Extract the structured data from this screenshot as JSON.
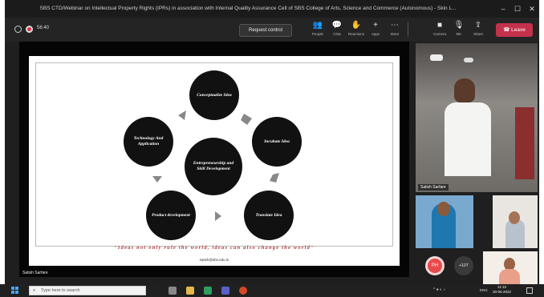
{
  "window": {
    "title": "SBS CTD/Webinar on Intellectual Property Rights (IPRs) in association with Internal Quality Assurance Cell of SBS College of Arts, Science and Commerce (Autonomous) - Skin L...",
    "controls": [
      "–",
      "☐",
      "✕"
    ]
  },
  "meeting_bar": {
    "timer": "56:40",
    "request_control": "Request control",
    "buttons": [
      {
        "label": "People",
        "icon": "people-icon"
      },
      {
        "label": "Chat",
        "icon": "chat-icon"
      },
      {
        "label": "Reactions",
        "icon": "reactions-icon"
      },
      {
        "label": "Apps",
        "icon": "apps-icon"
      },
      {
        "label": "More",
        "icon": "more-icon"
      },
      {
        "label": "Camera",
        "icon": "camera-icon"
      },
      {
        "label": "Mic",
        "icon": "mic-icon"
      },
      {
        "label": "Share",
        "icon": "share-icon"
      }
    ],
    "leave": "Leave"
  },
  "slide": {
    "nodes": [
      {
        "label": "Conceptualize Idea"
      },
      {
        "label": "Incubate Idea"
      },
      {
        "label": "Translate Idea"
      },
      {
        "label": "Product development"
      },
      {
        "label": "Technology And Application"
      },
      {
        "label": "Entrepreneurship and Skill Development"
      }
    ],
    "quote": "\"Ideas not only rule the world, ideas can also change the world\"",
    "email": "satish@sbs.edu.in"
  },
  "presenter_label": "Satish Sarfare",
  "side": {
    "main_tile_name": "Satish Sarfare",
    "avatar_initials": "PH",
    "overflow_count": "+107"
  },
  "taskbar": {
    "search_placeholder": "Type here to search",
    "clock_time": "11:10",
    "clock_date": "30-05-2022",
    "language": "ENG"
  },
  "colors": {
    "leave": "#c4314b",
    "quote": "#b5383a",
    "avatar": "#e84a4a"
  }
}
